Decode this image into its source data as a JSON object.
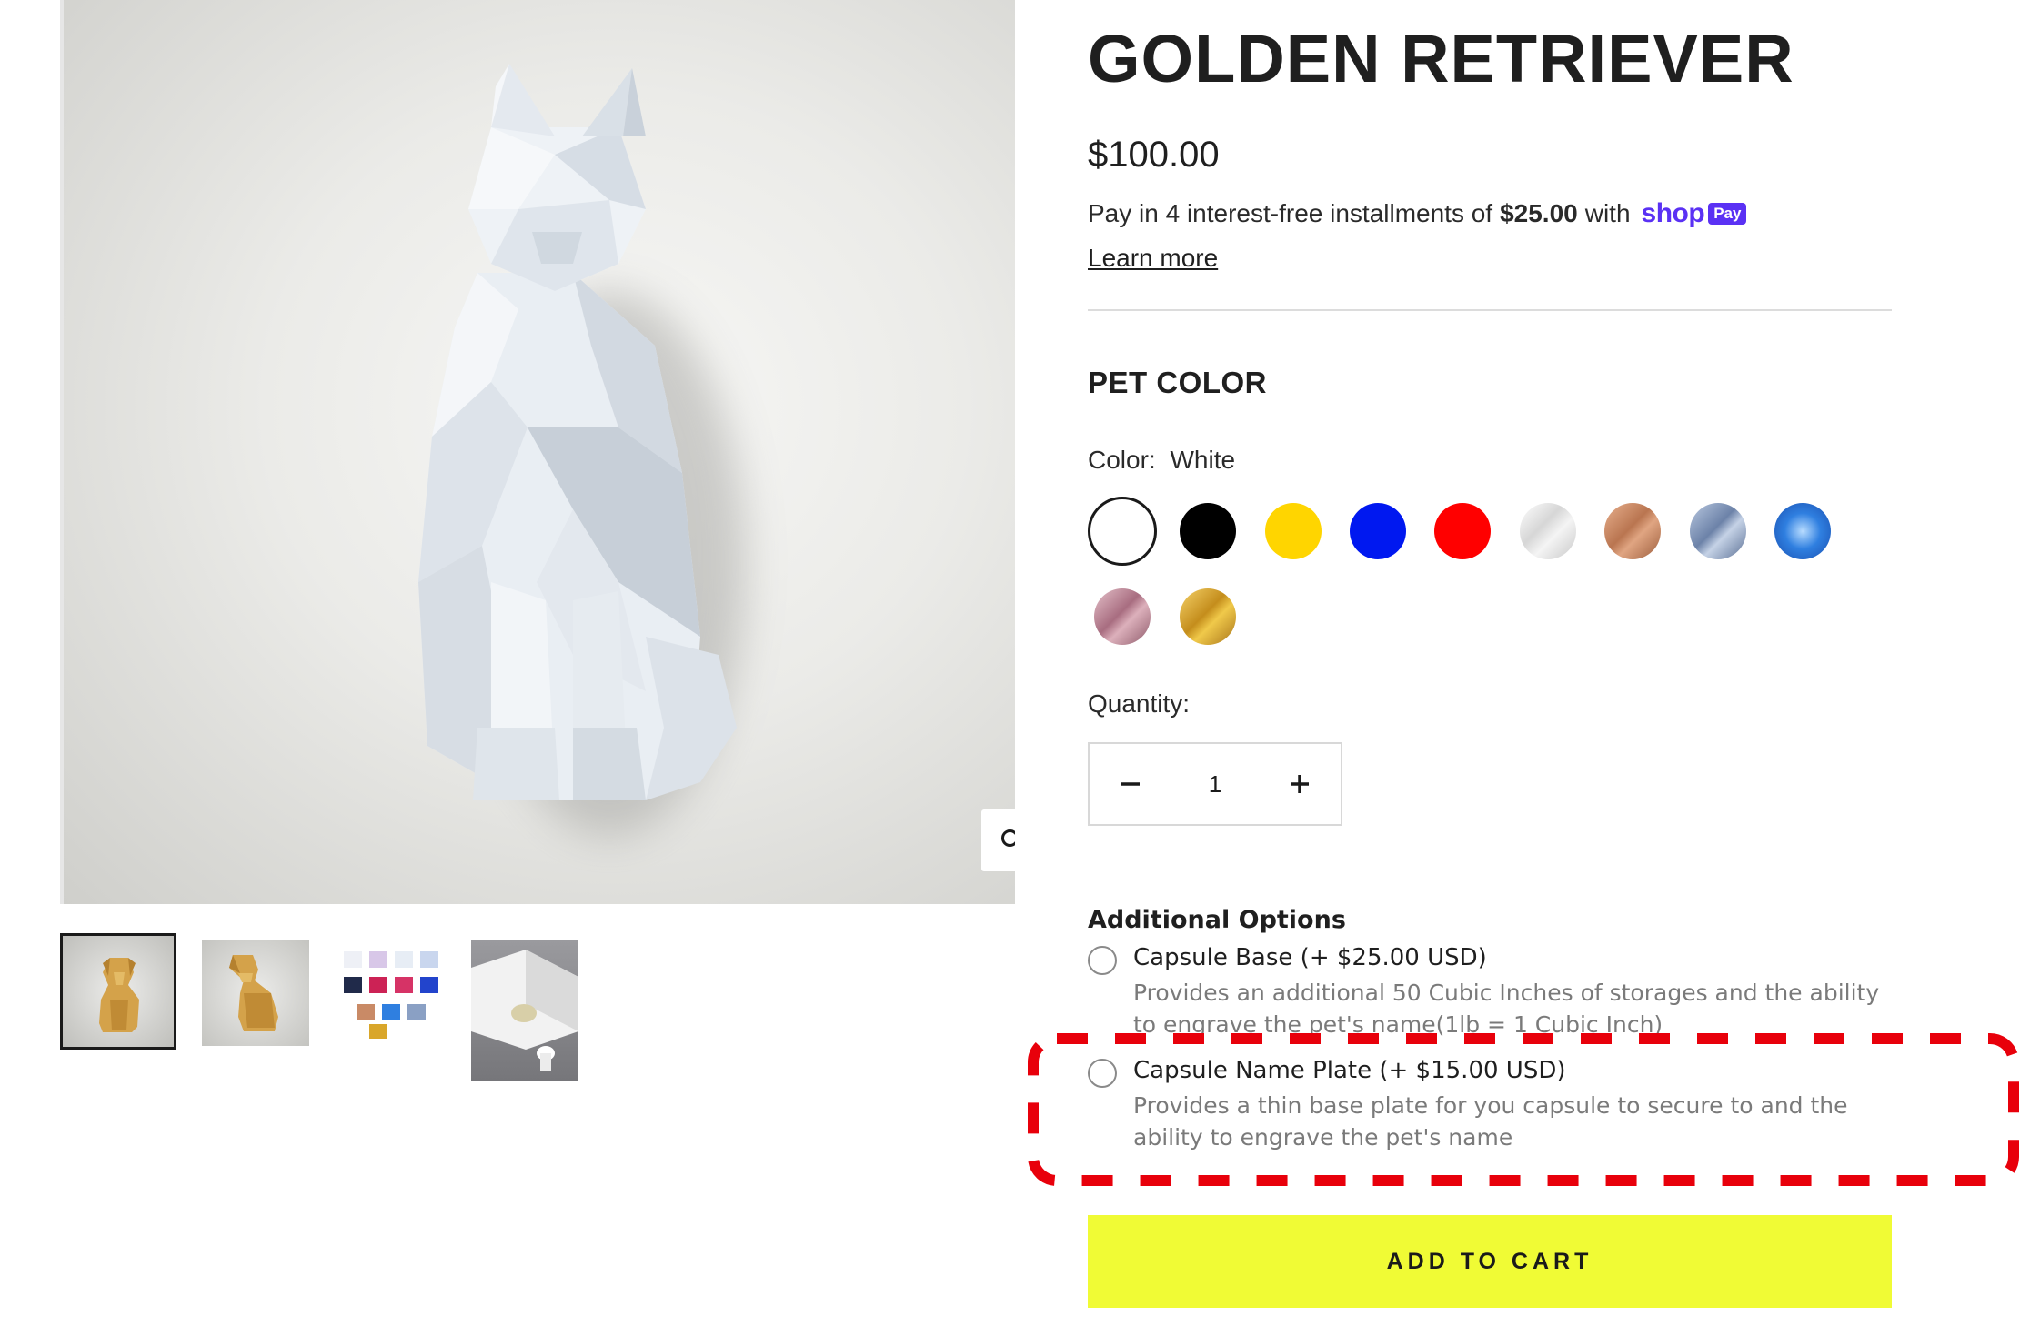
{
  "product": {
    "title": "GOLDEN RETRIEVER",
    "price": "$100.00",
    "installments_prefix": "Pay in 4 interest-free installments of",
    "installment_amount": "$25.00",
    "installments_suffix": "with",
    "shop_pay_word": "shop",
    "shop_pay_badge": "Pay",
    "learn_more": "Learn more"
  },
  "gallery": {
    "main_image": "white-low-poly-cat-sculpture",
    "zoom_icon": "search-icon",
    "thumbnails": [
      {
        "name": "golden-dog-front",
        "selected": true
      },
      {
        "name": "golden-dog-side",
        "selected": false
      },
      {
        "name": "color-chart",
        "selected": false
      },
      {
        "name": "capsule-base-detail",
        "selected": false
      }
    ]
  },
  "pet_color": {
    "heading": "PET COLOR",
    "label": "Color:",
    "selected": "White",
    "swatches": [
      {
        "name": "white",
        "color": "#ffffff"
      },
      {
        "name": "black",
        "color": "#000000"
      },
      {
        "name": "yellow",
        "color": "#ffd500"
      },
      {
        "name": "blue",
        "color": "#0018f0"
      },
      {
        "name": "red",
        "color": "#ff0000"
      },
      {
        "name": "silver",
        "color": "#e4e4e4"
      },
      {
        "name": "copper",
        "color": "#c98a66"
      },
      {
        "name": "steel-blue",
        "color": "#8aa0c4"
      },
      {
        "name": "metallic-blue",
        "color": "#2f7fe0"
      },
      {
        "name": "rose",
        "color": "#c99aa6"
      },
      {
        "name": "gold",
        "color": "#d9a62a"
      }
    ]
  },
  "quantity": {
    "label": "Quantity:",
    "value": "1",
    "minus": "−",
    "plus": "+"
  },
  "additional_options": {
    "heading": "Additional Options",
    "options": [
      {
        "label": "Capsule Base (+ $25.00 USD)",
        "description": "Provides an additional 50 Cubic Inches of storages and the ability to engrave the pet's name(1lb = 1 Cubic Inch)",
        "checked": false
      },
      {
        "label": "Capsule Name Plate (+ $15.00 USD)",
        "description": "Provides a thin base plate for you capsule to secure to and the ability to engrave the pet's name",
        "checked": false
      }
    ]
  },
  "cart": {
    "button_label": "ADD TO CART",
    "button_color": "#f0fb35"
  },
  "annotation": {
    "highlight_color": "#e8000b"
  }
}
